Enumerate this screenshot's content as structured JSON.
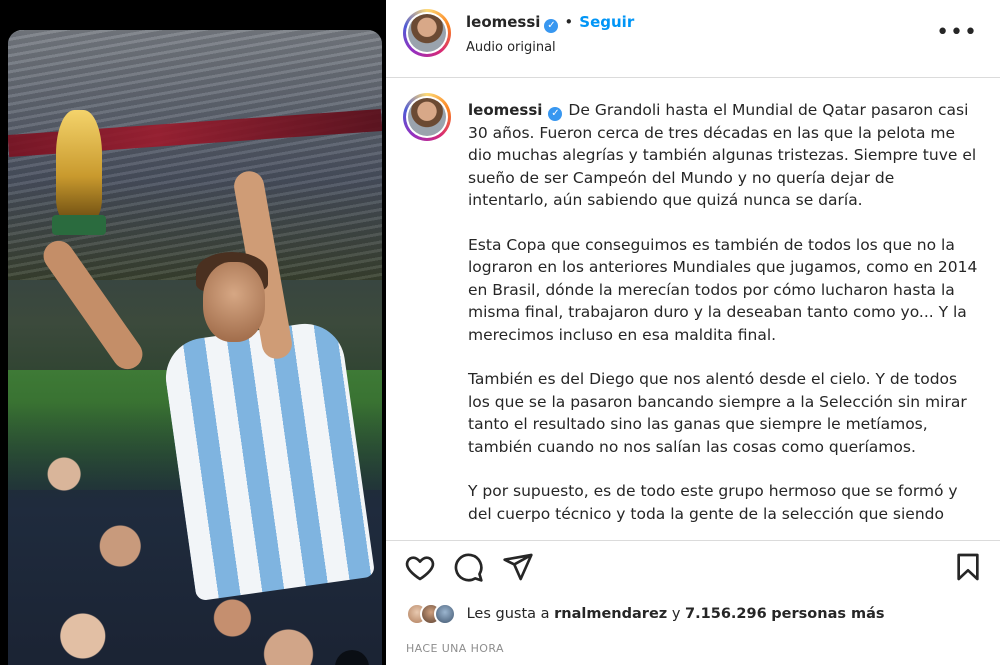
{
  "post": {
    "username": "leomessi",
    "follow_label": "Seguir",
    "audio_label": "Audio original",
    "more_label": "•••",
    "caption_paragraphs": [
      "De Grandoli hasta el Mundial de Qatar pasaron casi 30 años. Fueron cerca de tres décadas en las que la pelota me dio muchas alegrías y también algunas tristezas. Siempre tuve el sueño de ser Campeón del Mundo y no quería dejar de intentarlo, aún sabiendo que quizá nunca se daría.",
      "Esta Copa que conseguimos es también de todos los que no la lograron en los anteriores Mundiales que jugamos, como en 2014 en Brasil, dónde la merecían todos por cómo lucharon hasta la misma final, trabajaron duro y la deseaban tanto como yo... Y la merecimos incluso en esa maldita final.",
      "También es del Diego que nos alentó desde el cielo. Y de todos los que se la pasaron bancando siempre a la Selección sin mirar tanto el resultado sino las ganas que siempre le metíamos, también cuando no nos salían las cosas como queríamos.",
      "Y por supuesto, es de todo este grupo hermoso que se formó y del cuerpo técnico y toda la gente de la selección que siendo"
    ],
    "likes": {
      "prefix": "Les gusta a",
      "user": "rnalmendarez",
      "connector": "y",
      "count": "7.156.296",
      "suffix": "personas más"
    },
    "timestamp": "HACE UNA HORA"
  },
  "icons": {
    "like": "heart-icon",
    "comment": "comment-icon",
    "share": "send-icon",
    "save": "bookmark-icon",
    "verified": "verified-badge-icon",
    "more": "more-options-icon"
  },
  "colors": {
    "follow": "#0095f6",
    "verified": "#3897f0",
    "timestamp": "#8e8e8e"
  }
}
